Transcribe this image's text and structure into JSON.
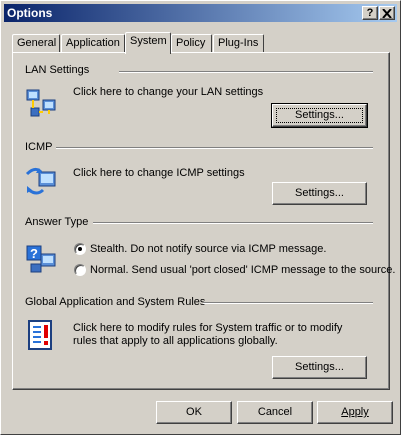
{
  "window": {
    "title": "Options",
    "help_label": "?",
    "close_label": "X"
  },
  "tabs": [
    {
      "label": "General"
    },
    {
      "label": "Application"
    },
    {
      "label": "System"
    },
    {
      "label": "Policy"
    },
    {
      "label": "Plug-Ins"
    }
  ],
  "lan": {
    "title": "LAN Settings",
    "description": "Click here to change your LAN settings",
    "button": "Settings..."
  },
  "icmp": {
    "title": "ICMP",
    "description": "Click here to change ICMP settings",
    "button": "Settings..."
  },
  "answer_type": {
    "title": "Answer Type",
    "options": [
      {
        "label": "Stealth. Do not notify source via ICMP message.",
        "selected": true
      },
      {
        "label": "Normal. Send usual 'port closed' ICMP message to the source.",
        "selected": false
      }
    ]
  },
  "global_rules": {
    "title": "Global Application and System Rules",
    "description_line1": "Click here to modify rules for System traffic or to modify",
    "description_line2": "rules that apply to all applications globally.",
    "button": "Settings..."
  },
  "footer": {
    "ok": "OK",
    "cancel": "Cancel",
    "apply": "Apply"
  }
}
